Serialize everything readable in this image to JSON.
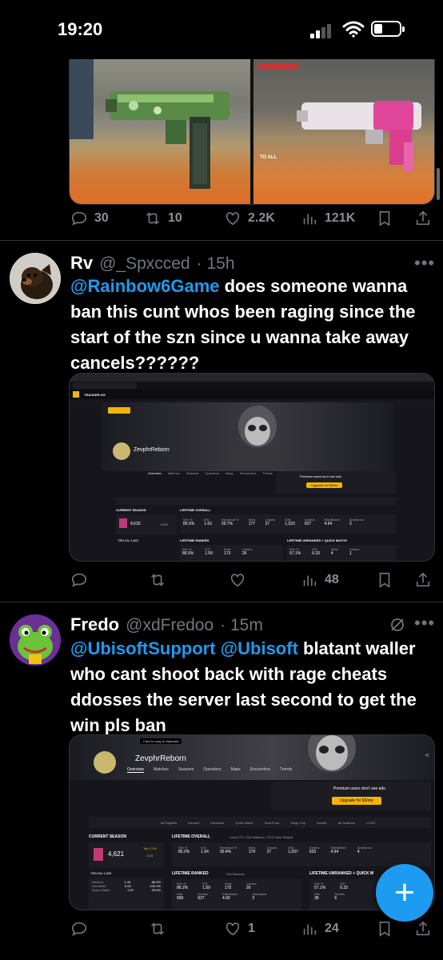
{
  "status_bar": {
    "time": "19:20"
  },
  "tweet1": {
    "media_label": "TO ALL",
    "actions": {
      "replies": "30",
      "retweets": "10",
      "likes": "2.2K",
      "views": "121K"
    }
  },
  "tweet2": {
    "name": "Rv",
    "handle": "@_Spxcced",
    "time": "· 15h",
    "mention": "@Rainbow6Game",
    "text": " does someone wanna ban this cunt whos been raging since the start of the szn since u wanna take away cancels??????",
    "actions": {
      "replies": "",
      "retweets": "",
      "likes": "",
      "views": "48"
    },
    "screenshot": {
      "brand": "TRACKER.GG",
      "profile_name": "ZevphrReborn",
      "tabs": [
        "Overview",
        "Matches",
        "Seasons",
        "Operators",
        "Maps",
        "Encounters",
        "Trends"
      ],
      "premium_text": "Premium users don't see ads.",
      "upgrade_btn": "Upgrade for $3/mo",
      "filters": [
        "All Playlists",
        "Ranked",
        "Unranked",
        "Quick Match",
        "Dual Front",
        "Siege Cup",
        "Arcade",
        "All Seasons",
        "Y11S1"
      ],
      "current_season": "CURRENT SEASON",
      "season_value": "4,633",
      "season_rank": "#109",
      "lifetime_overall": "LIFETIME OVERALL",
      "lifetime_ranked": "LIFETIME RANKED",
      "lifetime_unranked": "LIFETIME UNRANKED + QUICK MATCH",
      "overall_stats": [
        {
          "label": "Win %",
          "value": "85.5%"
        },
        {
          "label": "K/D",
          "value": "1.63"
        },
        {
          "label": "Headshot %",
          "value": "39.7%"
        },
        {
          "label": "Wins",
          "value": "177"
        },
        {
          "label": "Losses",
          "value": "27"
        },
        {
          "label": "Kills",
          "value": "1,023"
        },
        {
          "label": "Deaths",
          "value": "627"
        },
        {
          "label": "Kills/Match",
          "value": "4.94"
        },
        {
          "label": "Abandons",
          "value": "3"
        }
      ],
      "ranked_stats": [
        {
          "label": "Win %",
          "value": "86.5%"
        },
        {
          "label": "K/D",
          "value": "1.59"
        },
        {
          "label": "Wins",
          "value": "173"
        },
        {
          "label": "Losses",
          "value": "26"
        }
      ],
      "unranked_stats": [
        {
          "label": "Win %",
          "value": "57.1%"
        },
        {
          "label": "K/D",
          "value": "6.33"
        },
        {
          "label": "Wins",
          "value": "4"
        },
        {
          "label": "Losses",
          "value": "1"
        }
      ],
      "trn_elo": "TRN Elo 1,822"
    }
  },
  "tweet3": {
    "name": "Fredo",
    "handle": "@xdFredoo",
    "time": "· 15m",
    "mention1": "@UbisoftSupport",
    "mention2": "@Ubisoft",
    "text": " blatant waller who cant shoot back with rage cheats ddosses the server last second to get the win pls ban",
    "actions": {
      "replies": "",
      "retweets": "",
      "likes": "1",
      "views": "24"
    },
    "screenshot": {
      "tooltip": "Click to copy to clipboard",
      "profile_name": "ZevphrReborn",
      "tabs": [
        "Overview",
        "Matches",
        "Seasons",
        "Operators",
        "Maps",
        "Encounters",
        "Trends"
      ],
      "premium_text": "Premium users don't see ads.",
      "upgrade_btn": "Upgrade for $3/mo",
      "filters": [
        "All Playlists",
        "Ranked",
        "Unranked",
        "Quick Match",
        "Dual Front",
        "Siege Cup",
        "Arcade",
        "All Seasons",
        "Y11S1"
      ],
      "current_season": "CURRENT SEASON",
      "season_value": "4,621",
      "season_rank": "#131",
      "top_pct": "Top 0.1%",
      "lifetime_overall": "LIFETIME OVERALL",
      "lifetime_sub": "Level 172 / 210 Matches / 727h Time Played",
      "lifetime_ranked": "LIFETIME RANKED",
      "ranked_sub": "203 Matches",
      "lifetime_unranked": "LIFETIME UNRANKED + QUICK M",
      "overall_stats": [
        {
          "label": "Win %",
          "value": "85.2%"
        },
        {
          "label": "K/D",
          "value": "1.64"
        },
        {
          "label": "Headshot %",
          "value": "39.4%"
        },
        {
          "label": "Wins",
          "value": "179"
        },
        {
          "label": "Losses",
          "value": "27"
        },
        {
          "label": "Kills",
          "value": "1,037"
        },
        {
          "label": "Deaths",
          "value": "633"
        },
        {
          "label": "Kills/Match",
          "value": "4.94"
        },
        {
          "label": "Abandons",
          "value": "4"
        }
      ],
      "ranked_stats": [
        {
          "label": "Win %",
          "value": "86.2%"
        },
        {
          "label": "K/D",
          "value": "1.59"
        },
        {
          "label": "Wins",
          "value": "175"
        },
        {
          "label": "Losses",
          "value": "26"
        }
      ],
      "ranked_stats2": [
        {
          "label": "Kills",
          "value": "999"
        },
        {
          "label": "Deaths",
          "value": "627"
        },
        {
          "label": "Kills/Match",
          "value": "4.92"
        },
        {
          "label": "Abandons",
          "value": "2"
        }
      ],
      "unranked_stats": [
        {
          "label": "Win %",
          "value": "57.1%"
        },
        {
          "label": "K/D",
          "value": "6.33"
        }
      ],
      "unranked_stats2": [
        {
          "label": "Kills",
          "value": "38"
        },
        {
          "label": "Deaths",
          "value": "6"
        }
      ],
      "trn_elo": "TRN Elo 1,835",
      "elo_rows": [
        {
          "label": "Ranked",
          "kd": "1.45",
          "win": "86.3%"
        },
        {
          "label": "Unranked",
          "kd": "6.00",
          "win": "100.0%"
        },
        {
          "label": "Quick Match",
          "kd": "2.67",
          "win": "25.0%"
        }
      ]
    }
  },
  "colors": {
    "accent": "#1d9bf0",
    "bg": "#000000",
    "tracker_bg": "#16161c"
  }
}
